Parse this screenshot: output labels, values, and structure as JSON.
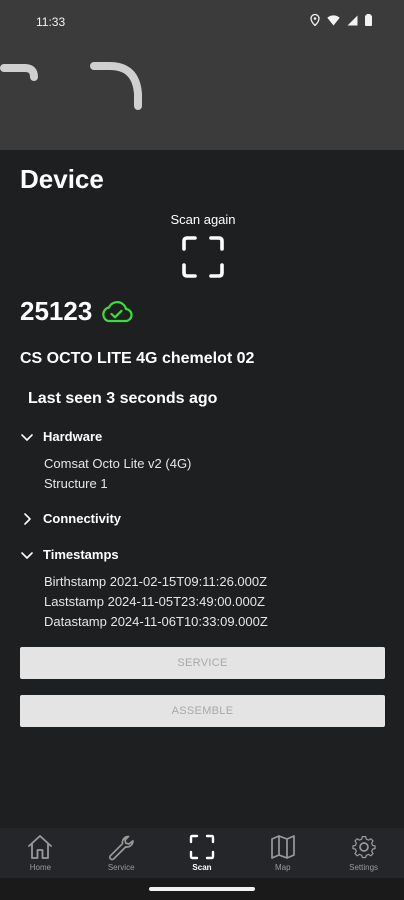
{
  "status_bar": {
    "time": "11:33"
  },
  "page": {
    "title": "Device"
  },
  "scan": {
    "label": "Scan again"
  },
  "device": {
    "id": "25123",
    "name": "CS OCTO LITE 4G chemelot 02",
    "last_seen": "Last seen 3 seconds ago",
    "status_color": "#3ddc3d"
  },
  "sections": {
    "hardware": {
      "label": "Hardware",
      "lines": [
        "Comsat Octo Lite v2 (4G)",
        "Structure 1"
      ],
      "expanded": true
    },
    "connectivity": {
      "label": "Connectivity",
      "expanded": false
    },
    "timestamps": {
      "label": "Timestamps",
      "expanded": true,
      "lines": [
        "Birthstamp 2021-02-15T09:11:26.000Z",
        "Laststamp 2024-11-05T23:49:00.000Z",
        "Datastamp 2024-11-06T10:33:09.000Z"
      ]
    }
  },
  "buttons": {
    "service": "SERVICE",
    "assemble": "ASSEMBLE"
  },
  "nav": {
    "items": [
      {
        "label": "Home",
        "icon": "home-icon"
      },
      {
        "label": "Service",
        "icon": "wrench-icon"
      },
      {
        "label": "Scan",
        "icon": "scan-icon",
        "active": true
      },
      {
        "label": "Map",
        "icon": "map-icon"
      },
      {
        "label": "Settings",
        "icon": "gear-icon"
      }
    ]
  }
}
